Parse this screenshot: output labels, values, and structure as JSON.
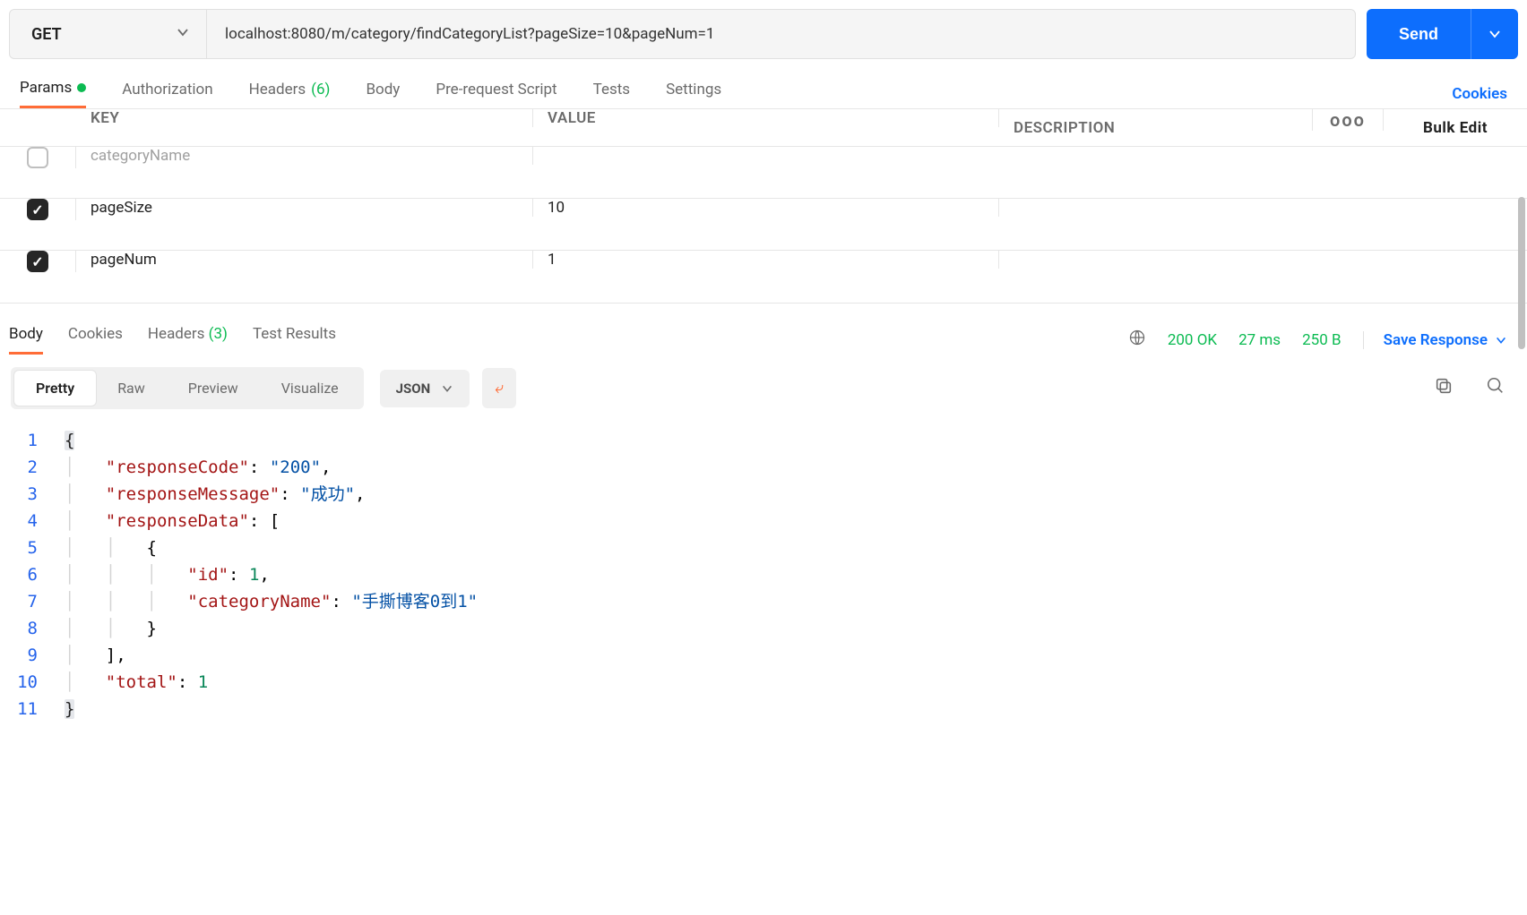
{
  "request": {
    "method": "GET",
    "url": "localhost:8080/m/category/findCategoryList?pageSize=10&pageNum=1",
    "send_label": "Send"
  },
  "cookies_link": "Cookies",
  "tabs": {
    "params": "Params",
    "authorization": "Authorization",
    "headers": "Headers",
    "headers_count": "(6)",
    "body": "Body",
    "prerequest": "Pre-request Script",
    "tests": "Tests",
    "settings": "Settings"
  },
  "params_table": {
    "columns": {
      "key": "KEY",
      "value": "VALUE",
      "description": "DESCRIPTION"
    },
    "more": "ooo",
    "bulk_edit": "Bulk Edit",
    "rows": [
      {
        "checked": false,
        "key": "categoryName",
        "key_is_placeholder": true,
        "value": "",
        "description": ""
      },
      {
        "checked": true,
        "key": "pageSize",
        "key_is_placeholder": false,
        "value": "10",
        "description": ""
      },
      {
        "checked": true,
        "key": "pageNum",
        "key_is_placeholder": false,
        "value": "1",
        "description": ""
      }
    ]
  },
  "response_tabs": {
    "body": "Body",
    "cookies": "Cookies",
    "headers": "Headers",
    "headers_count": "(3)",
    "test_results": "Test Results"
  },
  "response_meta": {
    "status": "200 OK",
    "time": "27 ms",
    "size": "250 B",
    "save": "Save Response"
  },
  "format": {
    "pretty": "Pretty",
    "raw": "Raw",
    "preview": "Preview",
    "visualize": "Visualize",
    "lang": "JSON"
  },
  "response_body": {
    "responseCode": "200",
    "responseMessage": "成功",
    "responseData_item_id": 1,
    "responseData_item_categoryName": "手撕博客0到1",
    "total": 1
  },
  "json_keys": {
    "responseCode": "\"responseCode\"",
    "responseMessage": "\"responseMessage\"",
    "responseData": "\"responseData\"",
    "id": "\"id\"",
    "categoryName": "\"categoryName\"",
    "total": "\"total\""
  },
  "json_vals": {
    "responseCode": "\"200\"",
    "responseMessage": "\"成功\"",
    "categoryName": "\"手撕博客0到1\""
  },
  "line_nums": [
    "1",
    "2",
    "3",
    "4",
    "5",
    "6",
    "7",
    "8",
    "9",
    "10",
    "11"
  ]
}
